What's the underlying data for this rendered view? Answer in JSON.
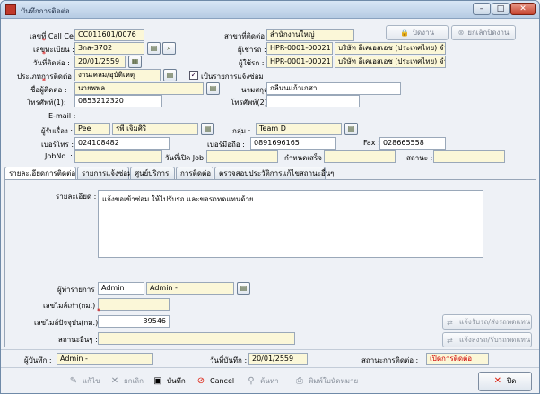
{
  "window": {
    "title": "บันทึกการติดต่อ",
    "minimize": "–",
    "maximize": "□",
    "close": "✕"
  },
  "toolbar": {
    "disabled_label": "ปิดงาน",
    "cancel_close_label": "ยกเลิกปิดงาน"
  },
  "form": {
    "call_center_no": {
      "label": "เลขที่ Call Center",
      "value": "CC011601/0076"
    },
    "contact_branch": {
      "label": "สาขาที่ติดต่อ :",
      "value": "สำนักงานใหญ่"
    },
    "plate": {
      "label": "เลขทะเบียน :",
      "value": "3กส-3702"
    },
    "renter": {
      "label": "ผู้เช่ารถ :",
      "code": "HPR-0001-00021",
      "name": "บริษัท อีเคเอสเอช (ประเทศไทย) จำกัด"
    },
    "contact_date": {
      "label": "วันที่ติดต่อ :",
      "value": "20/01/2559"
    },
    "user": {
      "label": "ผู้ใช้รถ :",
      "code": "HPR-0001-00021",
      "name": "บริษัท อีเคเอสเอช (ประเทศไทย) จำกัด"
    },
    "contact_type": {
      "label": "ประเภทการติดต่อ :",
      "value": "งานเคลม/อุบัติเหตุ"
    },
    "repair_check": {
      "label": "เป็นรายการแจ้งซ่อม",
      "checked": "✓"
    },
    "contact_name": {
      "label": "ชื่อผู้ติดต่อ :",
      "value": "นายพพล"
    },
    "surname": {
      "label": "นามสกุล :",
      "value": "กลีนนแก้วเกศา"
    },
    "phone1": {
      "label": "โทรศัพท์(1):",
      "value": "0853212320"
    },
    "phone2": {
      "label": "โทรศัพท์(2):",
      "value": ""
    },
    "email": {
      "label": "E-mail :",
      "value": ""
    },
    "coordinator": {
      "label": "ผู้รับเรื่อง :",
      "code": "Pee",
      "name": "รพี เจิมศิริ"
    },
    "group": {
      "label": "กลุ่ม :",
      "value": "Team D"
    },
    "office_phone": {
      "label": "เบอร์โทร :",
      "value": "024108482"
    },
    "mobile": {
      "label": "เบอร์มือถือ :",
      "value": "0891696165"
    },
    "fax": {
      "label": "Fax :",
      "value": "028665558"
    },
    "job_no": {
      "label": "JobNo. :",
      "value": ""
    },
    "job_open_date": {
      "label": "วันที่เปิด Job :",
      "value": ""
    },
    "due_date": {
      "label": "กำหนดเสร็จ :",
      "value": ""
    },
    "status": {
      "label": "สถานะ :",
      "value": ""
    }
  },
  "tabs": [
    {
      "label": "รายละเอียดการติดต่อ"
    },
    {
      "label": "รายการแจ้งซ่อม"
    },
    {
      "label": "ศูนย์บริการ"
    },
    {
      "label": "การติดต่อ"
    },
    {
      "label": "ตรวจสอบประวัติการแก้ไขสถานะอื่นๆ"
    }
  ],
  "detail": {
    "detail_label": "รายละเอียด :",
    "detail_text": "แจ้งขอเข้าซ่อม ให้ไปรับรถ และขอรถทดแทนด้วย",
    "operator": {
      "label": "ผู้ทำรายการ :",
      "code": "Admin",
      "name": "Admin -"
    },
    "old_mileage": {
      "label": "เลขไมล์เก่า(กม.) :",
      "value": ""
    },
    "current_mileage": {
      "label": "เลขไมล์ปัจจุบัน(กม.) :",
      "value": "39546"
    },
    "other_status": {
      "label": "สถานะอื่นๆ :",
      "value": ""
    },
    "receive_car_btn": "แจ้งรับรถ/ส่งรถทดแทน",
    "send_car_btn": "แจ้งส่งรถ/รับรถทดแทน"
  },
  "statusbar": {
    "recorder": {
      "label": "ผู้บันทึก :",
      "value": "Admin -"
    },
    "record_date": {
      "label": "วันที่บันทึก :",
      "value": "20/01/2559"
    },
    "contact_status": {
      "label": "สถานะการติดต่อ :",
      "value": "เปิดการติดต่อ"
    }
  },
  "buttons": {
    "edit": "แก้ไข",
    "cancel_doc": "ยกเลิก",
    "save": "บันทึก",
    "cancel": "Cancel",
    "search": "ค้นหา",
    "print": "พิมพ์ใบนัดหมาย",
    "close": "ปิด"
  },
  "colors": {
    "status_red": "#d00000",
    "yellow_field": "#fbf7d8"
  }
}
